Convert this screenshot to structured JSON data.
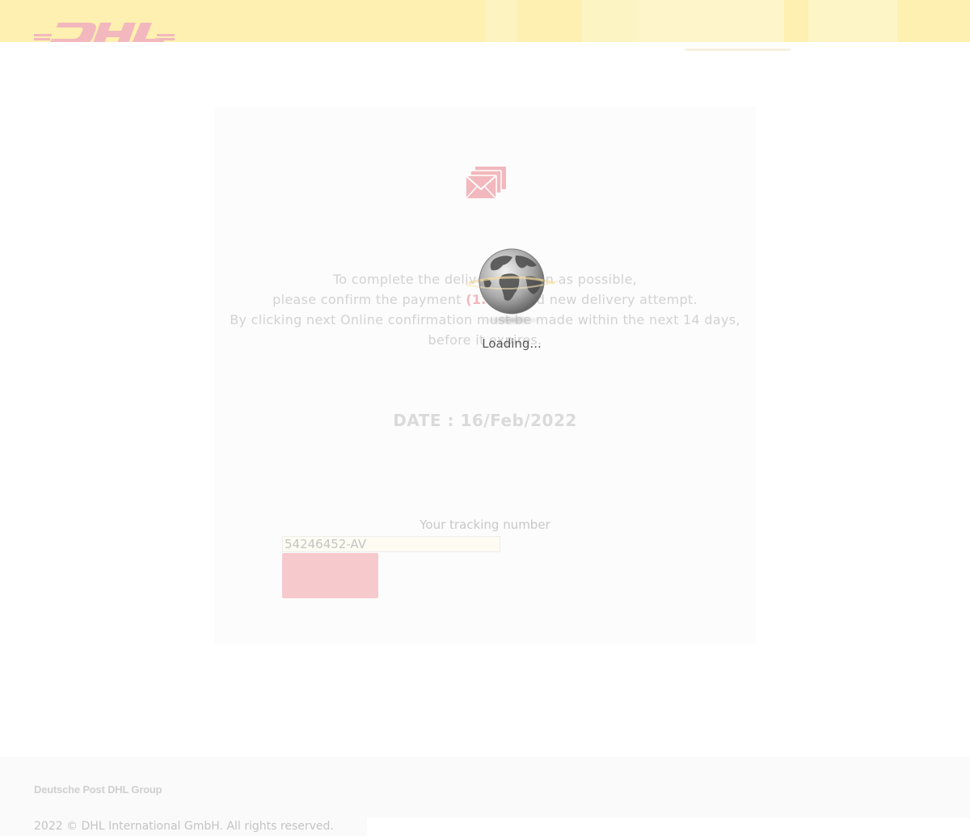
{
  "header": {
    "logo_icon": "dhl-logo-icon",
    "colors": {
      "background": "#fdf0b0",
      "logo": "#f2b8bd"
    }
  },
  "card": {
    "icon": "envelope-stack-icon",
    "message": {
      "line1": "To complete the delivery as soon as possible,",
      "line2_before": "please confirm the payment ",
      "amount": "(1.65 )",
      "line2_after": " and new delivery attempt.",
      "line3": "By clicking next Online confirmation must be made within the next 14 days,",
      "line4": "before it expires."
    },
    "date": "DATE : 16/Feb/2022",
    "tracking": {
      "label": "Your tracking number",
      "value": "54246452-AV"
    },
    "next_button": {
      "label": "",
      "color": "#f6c9cd"
    }
  },
  "loading": {
    "icon": "globe-icon",
    "text": "Loading..."
  },
  "footer": {
    "brand": "Deutsche Post DHL Group",
    "copyright": "2022 © DHL International GmbH. All rights reserved."
  }
}
